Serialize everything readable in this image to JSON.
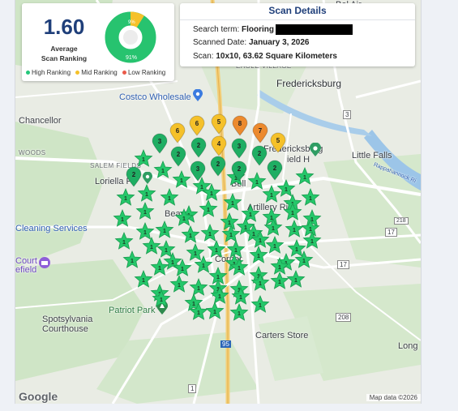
{
  "summary": {
    "score": "1.60",
    "score_label_line1": "Average",
    "score_label_line2": "Scan Ranking",
    "donut": {
      "high_pct": 91,
      "mid_pct": 9,
      "low_pct": 0
    },
    "donut_high_text": "91%",
    "donut_mid_text": "9%",
    "legend": [
      {
        "label": "High Ranking",
        "color": "#25c77a"
      },
      {
        "label": "Mid Ranking",
        "color": "#f5c12a"
      },
      {
        "label": "Low Ranking",
        "color": "#ea5a4a"
      }
    ]
  },
  "details": {
    "title": "Scan Details",
    "search_term_label": "Search term:",
    "search_term_value": "Flooring",
    "scanned_date_label": "Scanned Date:",
    "scanned_date_value": "January 3, 2026",
    "scan_label": "Scan:",
    "scan_value": "10x10, 63.62 Square Kilometers"
  },
  "map": {
    "labels": {
      "fredericksburg": "Fredericksburg",
      "chancellor": "Chancellor",
      "costco": "Costco Wholesale",
      "woods": "WOODS",
      "salem_fields": "SALEM FIELDS",
      "loriella": "Loriella P",
      "little_falls": "Little Falls",
      "fredericksburg_small1": "Fredericksburg",
      "fredericksburg_small2": "ield H",
      "cleaning": "Cleaning Services",
      "court": "Court",
      "field": "efield",
      "bell": "Bell",
      "artillery": "Artillery Ridg",
      "beav": "Beav",
      "corner": "Corner",
      "patriot": "Patriot Park",
      "spotsylvania1": "Spotsylvania",
      "spotsylvania2": "Courthouse",
      "carters": "Carters Store",
      "long": "Long",
      "eagle": "EAGLE VILLAGE",
      "bel_air": "Bel Air",
      "rappahannock": "Rappahannock Ri",
      "route_3": "3",
      "route_17a": "17",
      "route_17b": "17",
      "route_95": "95",
      "route_1": "1",
      "route_208": "208",
      "route_218": "218"
    },
    "attribution": "Map data ©2026",
    "logo": "Google"
  },
  "markers": {
    "pins": [
      {
        "rank": "6",
        "color": "#f5c12a"
      },
      {
        "rank": "6",
        "color": "#f5c12a"
      },
      {
        "rank": "5",
        "color": "#f5c12a"
      },
      {
        "rank": "8",
        "color": "#ec8a2e"
      },
      {
        "rank": "7",
        "color": "#ec8a2e"
      },
      {
        "rank": "5",
        "color": "#f5c12a"
      },
      {
        "rank": "3",
        "color": "#1fae63"
      },
      {
        "rank": "2",
        "color": "#1fae63"
      },
      {
        "rank": "4",
        "color": "#f5c12a"
      },
      {
        "rank": "3",
        "color": "#1fae63"
      },
      {
        "rank": "2",
        "color": "#1fae63"
      },
      {
        "rank": "2",
        "color": "#1fae63"
      },
      {
        "rank": "2",
        "color": "#1fae63"
      },
      {
        "rank": "2",
        "color": "#1fae63"
      },
      {
        "rank": "3",
        "color": "#1fae63"
      },
      {
        "rank": "2",
        "color": "#1fae63"
      },
      {
        "rank": "2",
        "color": "#1fae63"
      }
    ],
    "star_rank": "1",
    "star_color": "#25c76a"
  }
}
